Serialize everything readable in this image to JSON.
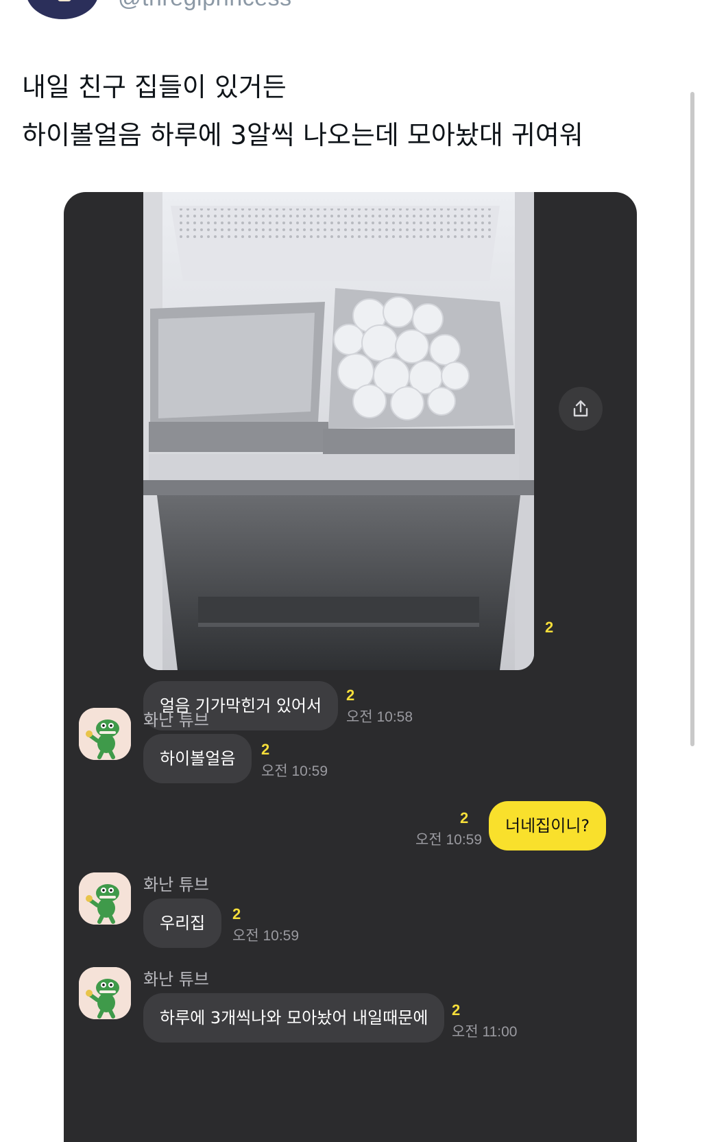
{
  "header": {
    "handle": "@thregiprincess"
  },
  "tweet": {
    "line1": "내일 친구 집들이 있거든",
    "line2": "하이볼얼음 하루에 3알씩 나오는데 모아놨대 귀여워"
  },
  "chat": {
    "photo_read_count": "2",
    "messages": [
      {
        "text": "얼음 기가막힌거 있어서",
        "count": "2",
        "time": "오전 10:58"
      },
      {
        "sender": "화난 튜브",
        "text": "하이볼얼음",
        "count": "2",
        "time": "오전 10:59"
      },
      {
        "text": "너네집이니?",
        "count": "2",
        "time": "오전 10:59"
      },
      {
        "sender": "화난 튜브",
        "text": "우리집",
        "count": "2",
        "time": "오전 10:59"
      },
      {
        "sender": "화난 튜브",
        "text": "하루에 3개씩나와 모아놨어 내일때문에",
        "count": "2",
        "time": "오전 11:00"
      }
    ]
  },
  "icons": {
    "share": "share-icon",
    "avatar": "tube-avatar-icon"
  },
  "colors": {
    "chat_background": "#2b2b2d",
    "bubble_other": "#3d3d40",
    "bubble_mine": "#f9e02c",
    "read_count": "#f6de3a"
  }
}
